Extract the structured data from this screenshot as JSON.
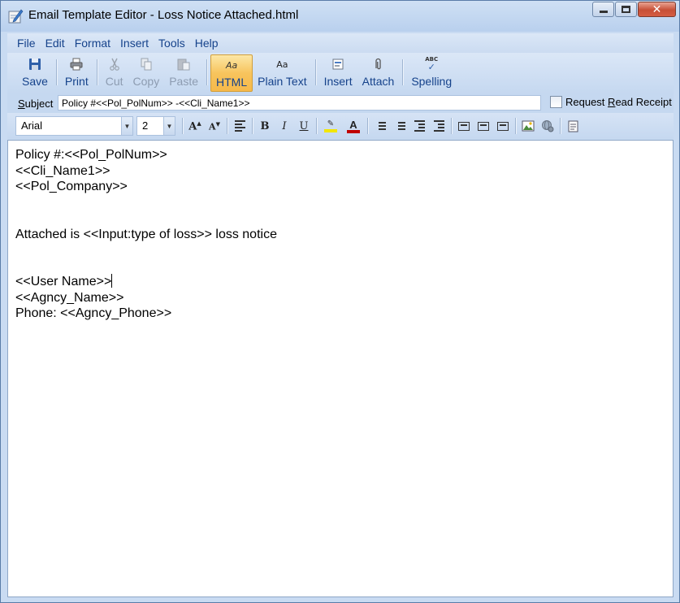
{
  "window": {
    "title": "Email Template Editor - Loss Notice Attached.html"
  },
  "menu": [
    "File",
    "Edit",
    "Format",
    "Insert",
    "Tools",
    "Help"
  ],
  "toolbar": {
    "save": "Save",
    "print": "Print",
    "cut": "Cut",
    "copy": "Copy",
    "paste": "Paste",
    "html": "HTML",
    "plain_text": "Plain Text",
    "insert": "Insert",
    "attach": "Attach",
    "spelling": "Spelling",
    "html_icon_text": "Aa",
    "plain_icon_text": "Aa",
    "spelling_icon_text": "ABC"
  },
  "subject": {
    "label_first": "S",
    "label_rest": "ubject",
    "value": "Policy #<<Pol_PolNum>> -<<Cli_Name1>>",
    "read_receipt_pre": "Request ",
    "read_receipt_u": "R",
    "read_receipt_post": "ead Receipt",
    "read_receipt_checked": false
  },
  "format": {
    "font": "Arial",
    "size": "2",
    "bold": "B",
    "italic": "I",
    "underline": "U",
    "font_color_letter": "A",
    "highlight_color": "#f2e600",
    "font_color": "#c00000"
  },
  "document": {
    "lines": [
      "Policy #:<<Pol_PolNum>>",
      "<<Cli_Name1>>",
      "<<Pol_Company>>",
      "",
      "",
      "Attached is <<Input:type of loss>> loss notice",
      "",
      "",
      "<<User Name>>",
      "<<Agncy_Name>>",
      "Phone: <<Agncy_Phone>>"
    ]
  },
  "colors": {
    "menu_text": "#15428b",
    "window_bg": "#c9dbf2",
    "active_button": "#f7c45d"
  }
}
